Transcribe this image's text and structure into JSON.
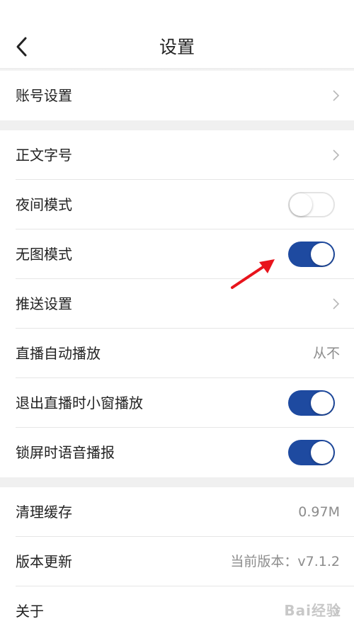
{
  "header": {
    "title": "设置",
    "back_icon": "chevron-left-icon"
  },
  "sections": {
    "account": {
      "label": "账号设置"
    },
    "font_size": {
      "label": "正文字号"
    },
    "night_mode": {
      "label": "夜间模式",
      "enabled": false
    },
    "no_image_mode": {
      "label": "无图模式",
      "enabled": true
    },
    "push_settings": {
      "label": "推送设置"
    },
    "live_autoplay": {
      "label": "直播自动播放",
      "value": "从不"
    },
    "live_pip": {
      "label": "退出直播时小窗播放",
      "enabled": true
    },
    "lock_voice": {
      "label": "锁屏时语音播报",
      "enabled": true
    },
    "clear_cache": {
      "label": "清理缓存",
      "value": "0.97M"
    },
    "version": {
      "label": "版本更新",
      "value": "当前版本：v7.1.2"
    },
    "about": {
      "label": "关于"
    }
  },
  "colors": {
    "toggle_on": "#1e4aa0",
    "annotation_arrow": "#e8141c"
  },
  "watermark": "Bai经验"
}
